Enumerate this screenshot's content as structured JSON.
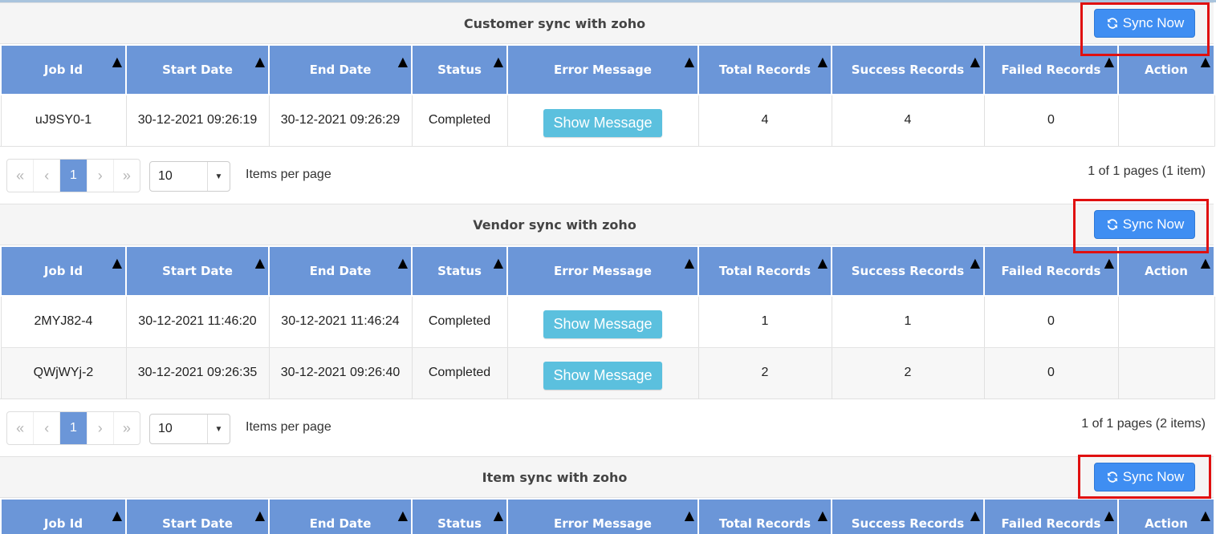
{
  "sections": [
    {
      "title": "Customer sync with zoho",
      "sync_label": "Sync Now",
      "rows": [
        {
          "job_id": "uJ9SY0-1",
          "start": "30-12-2021 09:26:19",
          "end": "30-12-2021 09:26:29",
          "status": "Completed",
          "total": "4",
          "success": "4",
          "failed": "0",
          "action": ""
        }
      ],
      "page_number": "1",
      "page_size": "10",
      "page_info": "1 of 1 pages (1 item)"
    },
    {
      "title": "Vendor sync with zoho",
      "sync_label": "Sync Now",
      "rows": [
        {
          "job_id": "2MYJ82-4",
          "start": "30-12-2021 11:46:20",
          "end": "30-12-2021 11:46:24",
          "status": "Completed",
          "total": "1",
          "success": "1",
          "failed": "0",
          "action": ""
        },
        {
          "job_id": "QWjWYj-2",
          "start": "30-12-2021 09:26:35",
          "end": "30-12-2021 09:26:40",
          "status": "Completed",
          "total": "2",
          "success": "2",
          "failed": "0",
          "action": ""
        }
      ],
      "page_number": "1",
      "page_size": "10",
      "page_info": "1 of 1 pages (2 items)"
    },
    {
      "title": "Item sync with zoho",
      "sync_label": "Sync Now"
    }
  ],
  "columns": [
    "Job Id",
    "Start Date",
    "End Date",
    "Status",
    "Error Message",
    "Total Records",
    "Success Records",
    "Failed Records",
    "Action"
  ],
  "show_message_label": "Show Message",
  "items_per_page_label": "Items per page",
  "pager_icons": {
    "first": "«",
    "prev": "‹",
    "next": "›",
    "last": "»"
  },
  "sort_icon": "▲",
  "dropdown_icon": "▼",
  "sync_icon": "refresh-icon",
  "colors": {
    "header_bg": "#6b96d8",
    "sync_button": "#3f8ef2",
    "show_message_button": "#5bc0de",
    "highlight": "#e01010"
  }
}
